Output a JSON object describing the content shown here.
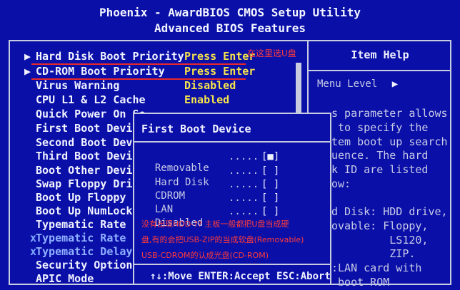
{
  "header": {
    "title": "Phoenix - AwardBIOS CMOS Setup Utility",
    "subtitle": "Advanced BIOS Features"
  },
  "menu": [
    {
      "label": "Hard Disk Boot Priority",
      "value": "Press Enter",
      "arrow": "▶"
    },
    {
      "label": "CD-ROM Boot Priority",
      "value": "Press Enter",
      "arrow": "▶"
    },
    {
      "label": "Virus Warning",
      "value": "Disabled"
    },
    {
      "label": "CPU L1 & L2 Cache",
      "value": "Enabled"
    },
    {
      "label": "Quick Power On Se"
    },
    {
      "label": "First Boot Device"
    },
    {
      "label": "Second Boot Devic"
    },
    {
      "label": "Third Boot Device"
    },
    {
      "label": "Boot Other Device"
    },
    {
      "label": "Swap Floppy Drive"
    },
    {
      "label": "Boot Up Floppy Se"
    },
    {
      "label": "Boot Up NumLock S"
    },
    {
      "label": "Typematic Rate Se"
    },
    {
      "label": "Typematic Rate (C",
      "prefix": "x"
    },
    {
      "label": "Typematic Delay (",
      "prefix": "x"
    },
    {
      "label": "Security Option"
    },
    {
      "label": "APIC Mode"
    }
  ],
  "annotation": "在这里选U盘",
  "help": {
    "title": "Item Help",
    "menu_level_label": "Menu Level",
    "chevron": "▶",
    "text": "s parameter allows\n to specify the\ntem boot up search\nuence. The hard\nk ID are listed\now:",
    "text2": "d Disk: HDD drive,\novable: Floppy,\n         LS120,\n         ZIP.\n:LAN card with\n boot ROM"
  },
  "popup": {
    "title": "First Boot Device",
    "options": [
      {
        "label": "Removable",
        "dots": ".....",
        "box": "[■]"
      },
      {
        "label": "Hard Disk",
        "dots": ".....",
        "box": "[ ]"
      },
      {
        "label": "CDROM",
        "dots": ".....",
        "box": "[ ]"
      },
      {
        "label": "LAN",
        "dots": ".....",
        "box": "[ ]"
      },
      {
        "label": "Disabled",
        "dots": ".....",
        "box": "[ ]"
      }
    ],
    "footer": "↑↓:Move ENTER:Accept ESC:Abort"
  },
  "notes": [
    "没有出现HDD-?? 主板一般都把U盘当成硬",
    "盘,有的会把USB-ZIP的当成软盘(Removable)",
    "USB-CDROM的认成光盘(CD-ROM)"
  ],
  "colors": {
    "background": "#0a0fa8",
    "value_yellow": "#f6e34a",
    "annotation_red": "#ff3b3b"
  }
}
